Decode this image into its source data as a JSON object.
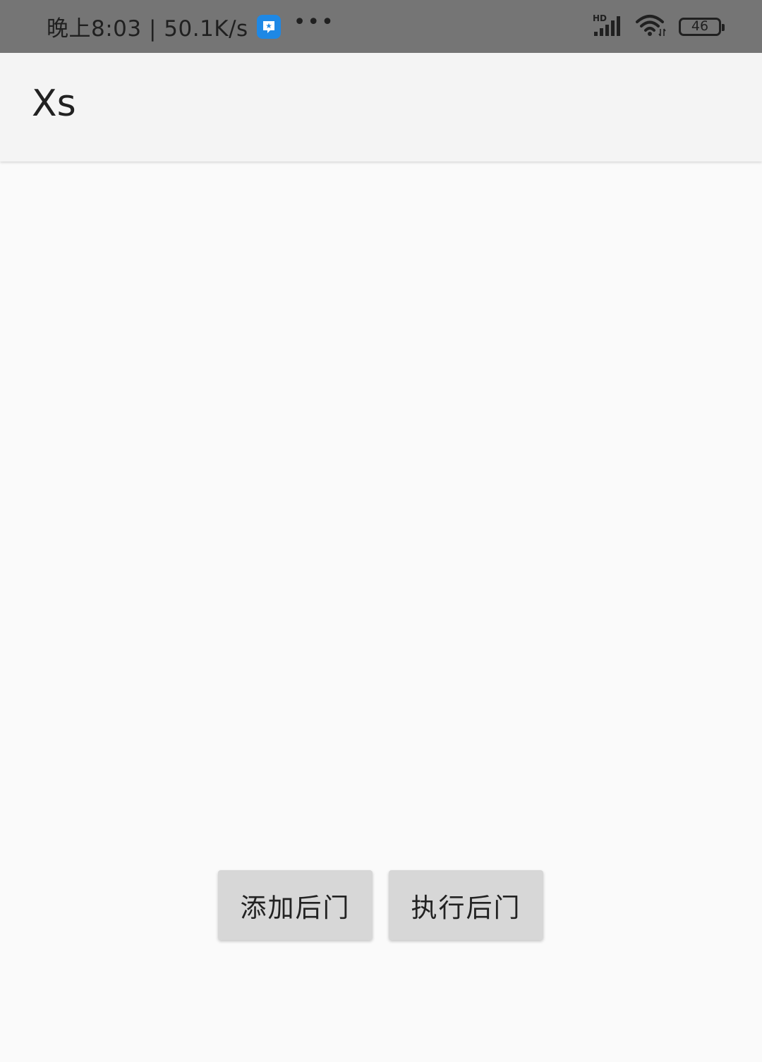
{
  "status_bar": {
    "time_speed": "晚上8:03 | 50.1K/s",
    "more": "•••",
    "network_type": "HD",
    "battery_level": "46",
    "notification_icon": "qq-notification-icon",
    "icons": [
      "signal-icon",
      "wifi-icon",
      "battery-icon"
    ]
  },
  "app_bar": {
    "title": "Xs"
  },
  "buttons": {
    "add_backdoor": "添加后门",
    "execute_backdoor": "执行后门"
  }
}
